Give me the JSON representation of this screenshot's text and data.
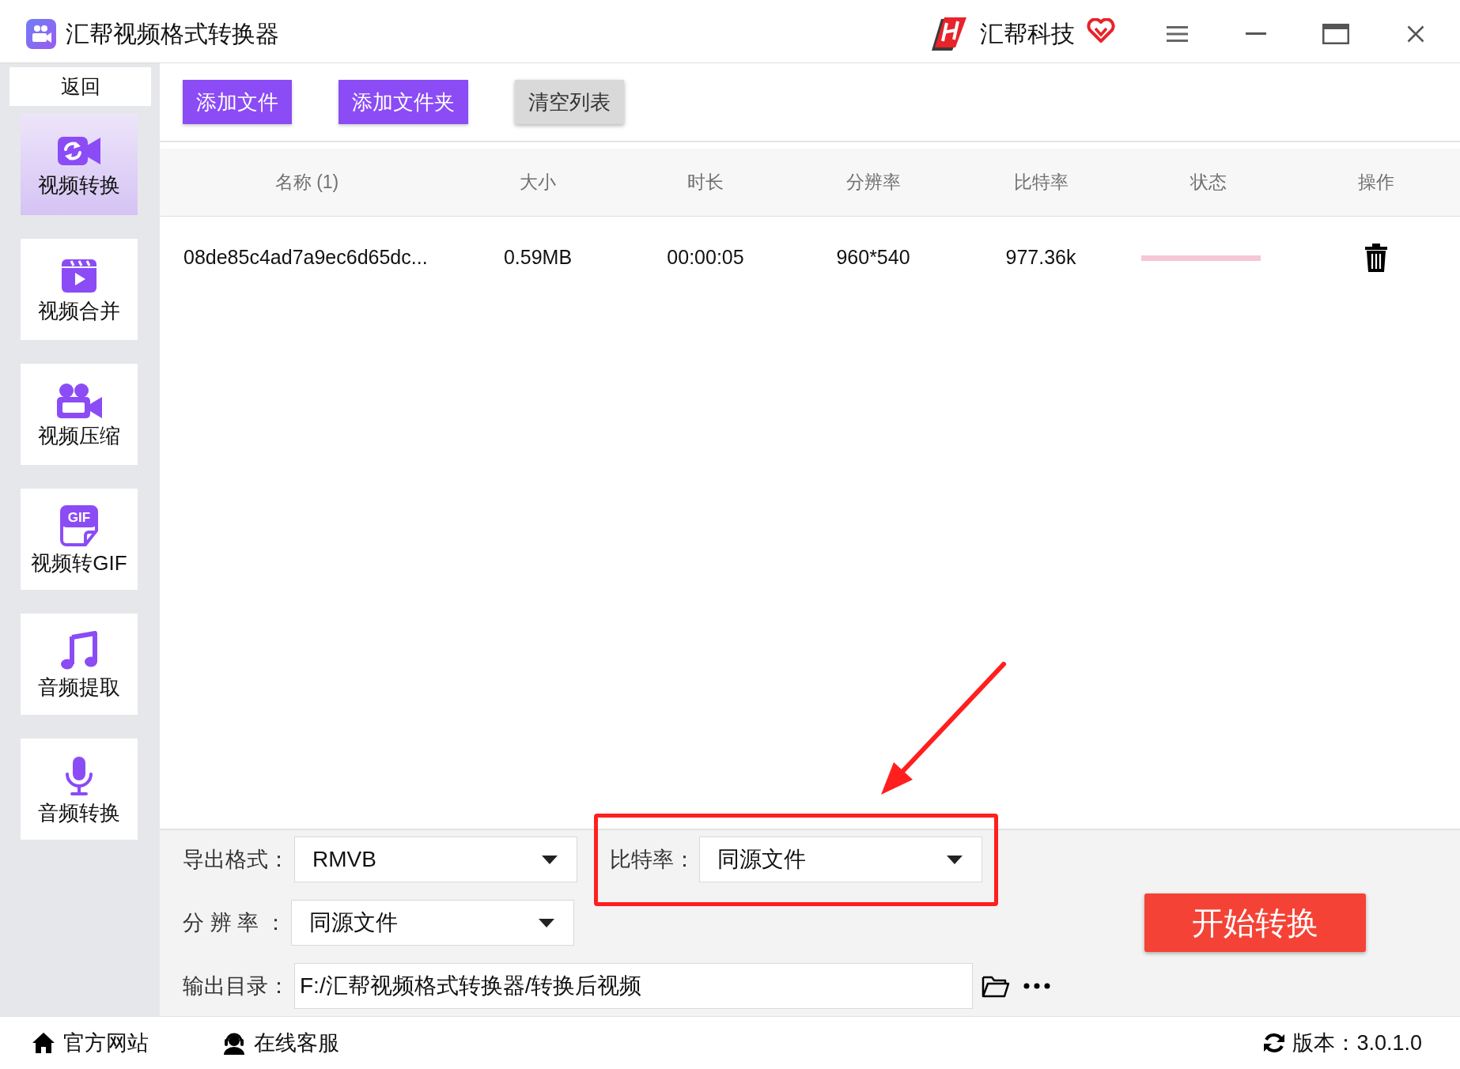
{
  "window": {
    "title": "汇帮视频格式转换器",
    "brand": "汇帮科技"
  },
  "sidebar": {
    "back": "返回",
    "items": [
      {
        "label": "视频转换",
        "kind": "convert",
        "selected": true
      },
      {
        "label": "视频合并",
        "kind": "merge",
        "selected": false
      },
      {
        "label": "视频压缩",
        "kind": "compress",
        "selected": false
      },
      {
        "label": "视频转GIF",
        "kind": "gif",
        "icon_text": "GIF",
        "selected": false
      },
      {
        "label": "音频提取",
        "kind": "audio_extract",
        "selected": false
      },
      {
        "label": "音频转换",
        "kind": "audio_convert",
        "selected": false
      }
    ]
  },
  "toolbar": {
    "buttons": [
      {
        "label": "添加文件",
        "kind": "primary"
      },
      {
        "label": "添加文件夹",
        "kind": "primary"
      },
      {
        "label": "清空列表",
        "kind": "secondary"
      }
    ]
  },
  "table": {
    "columns": [
      "名称 (1)",
      "大小",
      "时长",
      "分辨率",
      "比特率",
      "状态",
      "操作"
    ],
    "rows": [
      {
        "cells": [
          "08de85c4ad7a9ec6d65dc...",
          "0.59MB",
          "00:00:05",
          "960*540",
          "977.36k"
        ]
      }
    ]
  },
  "settings": {
    "format": {
      "label": "导出格式：",
      "value": "RMVB"
    },
    "bitrate": {
      "label": "比特率：",
      "value": "同源文件",
      "highlighted": true
    },
    "resolution": {
      "label": "分 辨 率 ：",
      "value": "同源文件"
    },
    "output_dir": {
      "label": "输出目录：",
      "value": "F:/汇帮视频格式转换器/转换后视频"
    }
  },
  "start_button": "开始转换",
  "footer": {
    "links": [
      {
        "label": "官方网站",
        "kind": "home"
      },
      {
        "label": "在线客服",
        "kind": "support"
      }
    ],
    "version": "版本：3.0.1.0"
  }
}
